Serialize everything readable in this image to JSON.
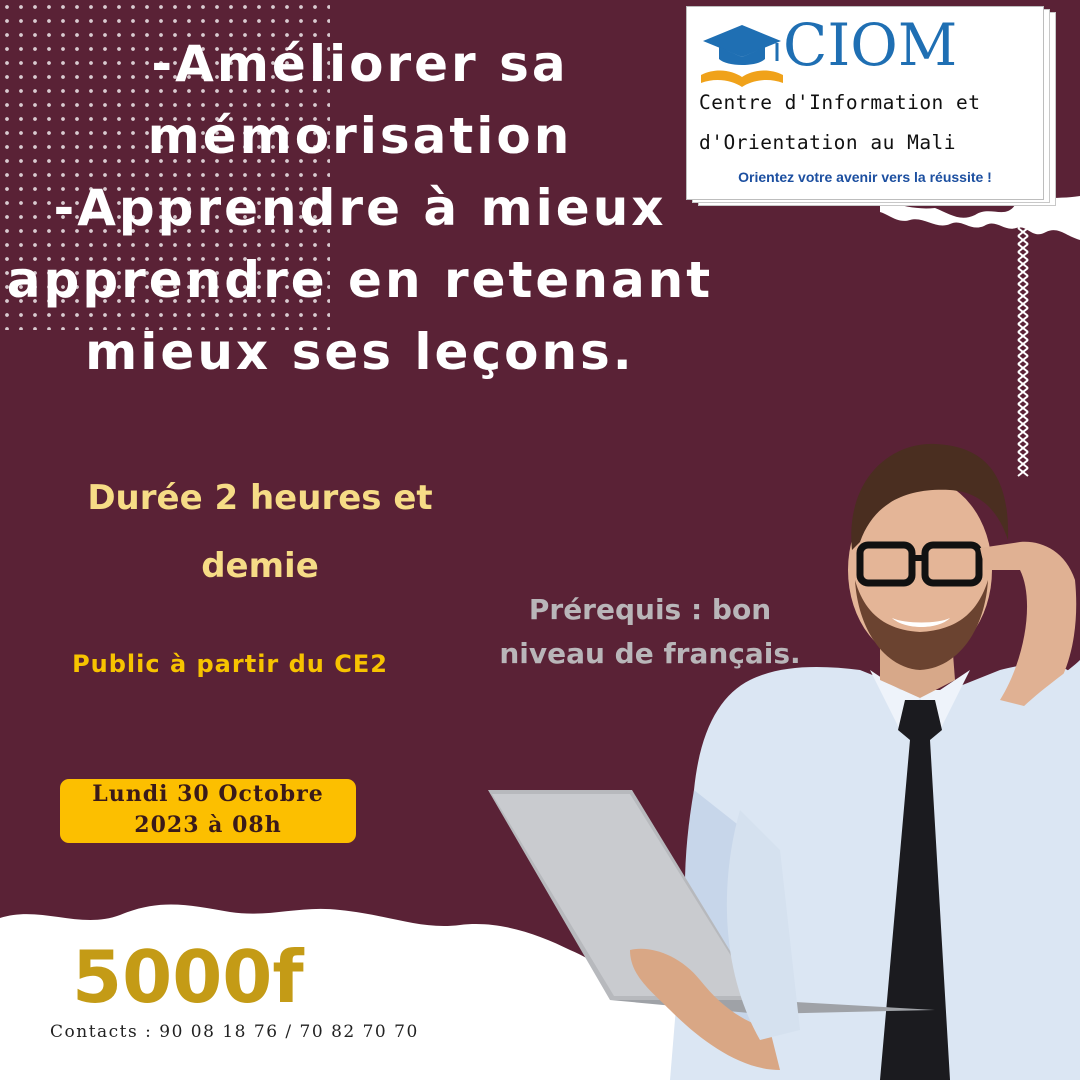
{
  "headline": {
    "line1": "-Améliorer sa",
    "line2": "mémorisation",
    "line3": "-Apprendre à mieux",
    "line4": "apprendre en retenant",
    "line5": "mieux ses leçons."
  },
  "duration": {
    "line1": "Durée 2 heures et",
    "line2": "demie"
  },
  "prerequisites": {
    "line1": "Prérequis : bon",
    "line2": "niveau de français."
  },
  "audience": "Public à partir du CE2",
  "session_date": {
    "line1": "Lundi 30 Octobre",
    "line2": "2023 à 08h"
  },
  "price": "5000f",
  "contacts": "Contacts : 90 08 18 76 / 70 82 70 70",
  "logo": {
    "title": "CIOM",
    "line1": "Centre d'Information et",
    "line2": "d'Orientation au Mali",
    "slogan": "Orientez votre avenir vers la réussite !"
  },
  "colors": {
    "background": "#5a2236",
    "headline": "#ffffff",
    "duration": "#f6dc86",
    "prerequisites": "#b9b6b9",
    "audience": "#f7c300",
    "date_badge": "#fcbf00",
    "price": "#c49b16",
    "logo_blue": "#1f6fb3"
  },
  "icons": [
    "graduation-cap-icon",
    "open-book-icon",
    "dot-pattern",
    "cross-stitch-chain"
  ]
}
